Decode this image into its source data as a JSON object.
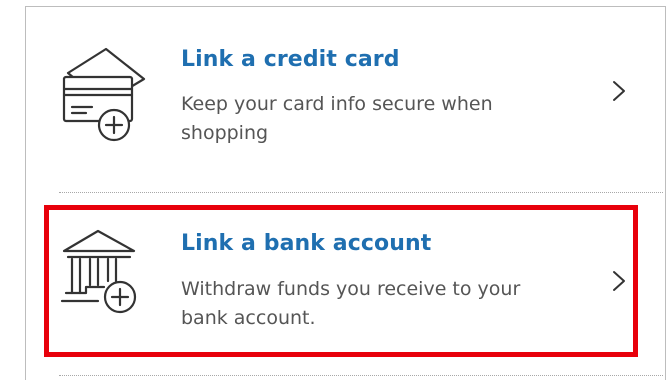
{
  "options": [
    {
      "title": "Link a credit card",
      "description": "Keep your card info secure when shopping",
      "icon": "credit-card-add-icon"
    },
    {
      "title": "Link a bank account",
      "description": "Withdraw funds you receive to your bank account.",
      "icon": "bank-add-icon",
      "highlighted": true
    }
  ],
  "chevron_icon": "chevron-right-icon",
  "colors": {
    "title": "#1f6fb0",
    "description": "#555555",
    "icon_stroke": "#333333",
    "highlight": "#e8000b",
    "divider": "#a8a8a8"
  }
}
